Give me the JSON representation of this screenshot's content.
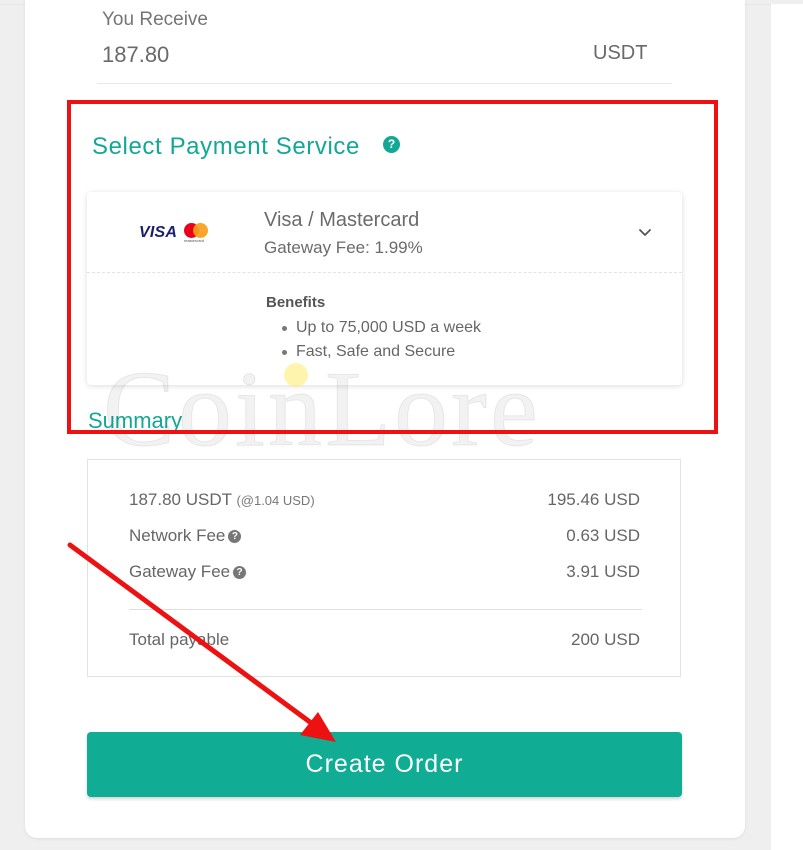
{
  "receive": {
    "label": "You Receive",
    "amount": "187.80",
    "currency": "USDT"
  },
  "payment_service": {
    "title": "Select Payment Service",
    "help_icon": "?",
    "selected": {
      "logo_visa": "VISA",
      "logo_mastercard": "mastercard",
      "name": "Visa / Mastercard",
      "fee": "Gateway Fee: 1.99%",
      "benefits_title": "Benefits",
      "benefits": [
        "Up to 75,000 USD a week",
        "Fast, Safe and Secure"
      ]
    }
  },
  "summary": {
    "title": "Summary",
    "rows": [
      {
        "label": "187.80 USDT",
        "rate": "(@1.04 USD)",
        "value": "195.46 USD"
      },
      {
        "label": "Network Fee",
        "value": "0.63 USD"
      },
      {
        "label": "Gateway Fee",
        "value": "3.91 USD"
      }
    ],
    "total": {
      "label": "Total payable",
      "value": "200 USD"
    }
  },
  "create_button": "Create Order",
  "watermark": "CoinLore",
  "colors": {
    "accent": "#13a895",
    "button": "#10ac94",
    "annotation": "#ee1111"
  }
}
